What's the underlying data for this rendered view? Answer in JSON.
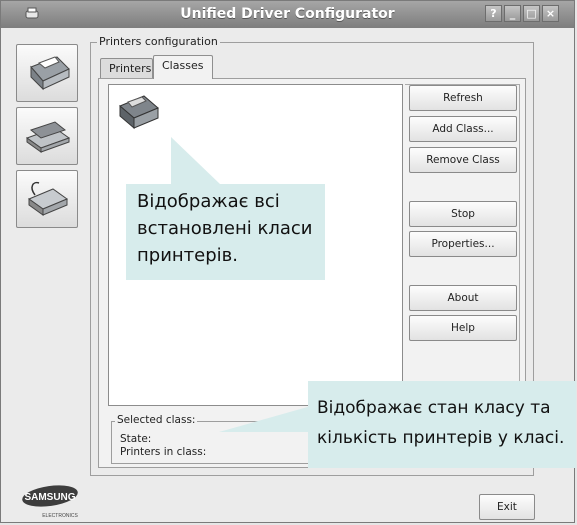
{
  "window": {
    "title": "Unified Driver Configurator",
    "controls": [
      "?",
      "_",
      "□",
      "×"
    ]
  },
  "sidebar": {
    "items": [
      {
        "name": "printer-icon"
      },
      {
        "name": "scanner-icon"
      },
      {
        "name": "port-icon"
      }
    ]
  },
  "group": {
    "label": "Printers configuration",
    "tabs": [
      {
        "label": "Printers",
        "active": false
      },
      {
        "label": "Classes",
        "active": true
      }
    ]
  },
  "buttons": {
    "refresh": "Refresh",
    "add_class": "Add Class...",
    "remove_class": "Remove Class",
    "stop": "Stop",
    "properties": "Properties...",
    "about": "About",
    "help": "Help",
    "exit": "Exit"
  },
  "selected": {
    "label": "Selected class:",
    "state_label": "State:",
    "printers_label": "Printers in class:"
  },
  "callouts": {
    "list_line1": "Відображає всі",
    "list_line2": "встановлені класи",
    "list_line3": "принтерів.",
    "state_line1": "Відображає стан класу та",
    "state_line2": "кількість принтерів у класі."
  },
  "logo": {
    "brand": "SAMSUNG",
    "sub": "ELECTRONICS"
  }
}
